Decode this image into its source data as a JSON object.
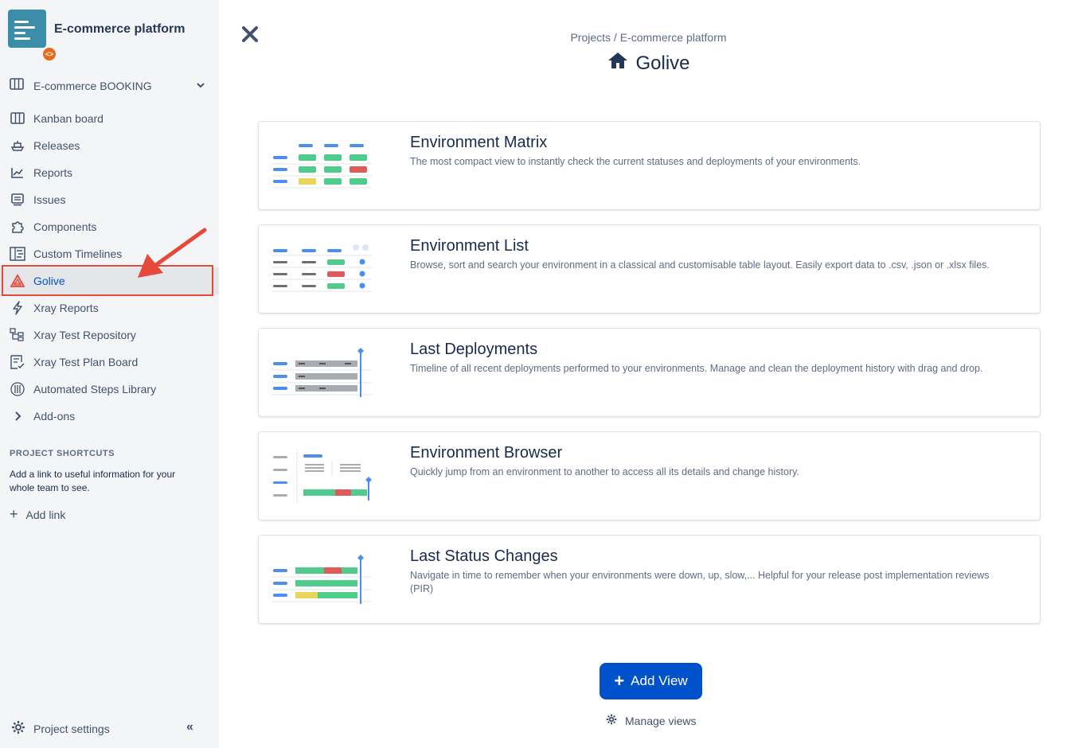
{
  "sidebar": {
    "project_name": "E-commerce platform",
    "project_badge": "<>",
    "board_selector": "E-commerce BOOKING",
    "items": [
      {
        "label": "Kanban board",
        "icon": "kanban-icon"
      },
      {
        "label": "Releases",
        "icon": "ship-icon"
      },
      {
        "label": "Reports",
        "icon": "chart-icon"
      },
      {
        "label": "Issues",
        "icon": "issues-icon"
      },
      {
        "label": "Components",
        "icon": "puzzle-icon"
      },
      {
        "label": "Custom Timelines",
        "icon": "timeline-icon"
      },
      {
        "label": "Golive",
        "icon": "golive-icon"
      },
      {
        "label": "Xray Reports",
        "icon": "bolt-icon"
      },
      {
        "label": "Xray Test Repository",
        "icon": "repository-icon"
      },
      {
        "label": "Xray Test Plan Board",
        "icon": "plan-board-icon"
      },
      {
        "label": "Automated Steps Library",
        "icon": "library-icon"
      },
      {
        "label": "Add-ons",
        "icon": "chevron-right-icon"
      }
    ],
    "shortcuts_title": "PROJECT SHORTCUTS",
    "shortcuts_desc": "Add a link to useful information for your whole team to see.",
    "add_link": "Add link",
    "project_settings": "Project settings",
    "collapse": "«"
  },
  "header": {
    "breadcrumb": "Projects / E-commerce platform",
    "title": "Golive"
  },
  "cards": [
    {
      "title": "Environment Matrix",
      "desc": "The most compact view to instantly check the current statuses and deployments of your environments."
    },
    {
      "title": "Environment List",
      "desc": "Browse, sort and search your environment in a classical and customisable table layout. Easily export data to .csv, .json or .xlsx files."
    },
    {
      "title": "Last Deployments",
      "desc": "Timeline of all recent deployments performed to your environments. Manage and clean the deployment history with drag and drop."
    },
    {
      "title": "Environment Browser",
      "desc": "Quickly jump from an environment to another to access all its details and change history."
    },
    {
      "title": "Last Status Changes",
      "desc": "Navigate in time to remember when your environments were down, up, slow,... Helpful for your release post implementation reviews (PIR)"
    }
  ],
  "actions": {
    "add_view": "Add View",
    "manage_views": "Manage views"
  },
  "colors": {
    "accent": "#0052CC",
    "highlight": "#E5493A",
    "sidebar_bg": "#F4F5F7"
  }
}
